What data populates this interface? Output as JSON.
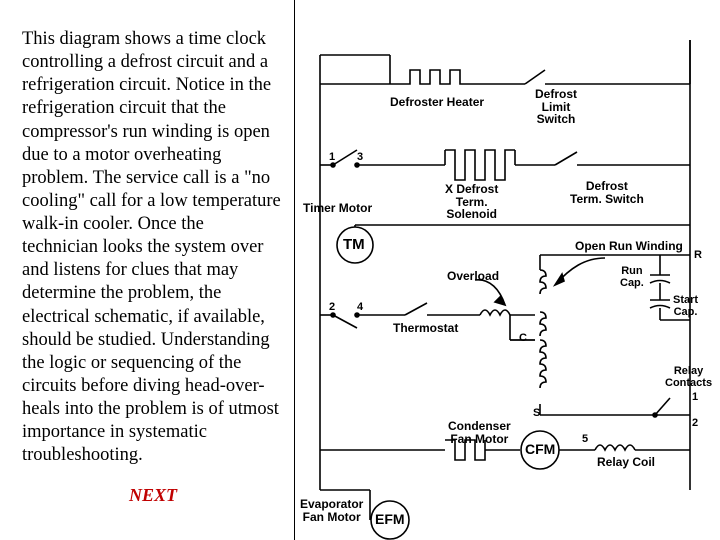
{
  "left": {
    "paragraph": "This diagram shows a time clock controlling a defrost circuit and a refrigeration circuit. Notice in the refrigeration circuit that the compressor's run winding is open due to a motor overheating problem. The service call is a \"no cooling\" call for a low temperature walk-in cooler. Once the technician looks the system over and listens for clues that may determine the problem, the electrical schematic, if available, should be studied. Understanding the logic or sequencing of the circuits before diving head-over-heals into the problem is of utmost importance in systematic troubleshooting.",
    "next": "NEXT"
  },
  "diagram": {
    "defroster_heater": "Defroster Heater",
    "defrost_limit_switch": "Defrost\nLimit\nSwitch",
    "timer_motor": "Timer Motor",
    "x_defrost_term_solenoid": "X Defrost\nTerm.\nSolenoid",
    "defrost_term_switch": "Defrost\nTerm. Switch",
    "tm": "TM",
    "open_run_winding": "Open Run Winding",
    "overload": "Overload",
    "thermostat": "Thermostat",
    "run_cap": "Run\nCap.",
    "start_cap": "Start\nCap.",
    "relay_contacts": "Relay\nContacts",
    "condenser_fan_motor": "Condenser\nFan Motor",
    "cfm": "CFM",
    "relay_coil": "Relay Coil",
    "evaporator_fan_motor": "Evaporator\nFan Motor",
    "efm": "EFM",
    "one": "1",
    "two": "2",
    "three": "3",
    "four": "4",
    "five": "5",
    "r": "R",
    "c": "C",
    "s": "S"
  }
}
